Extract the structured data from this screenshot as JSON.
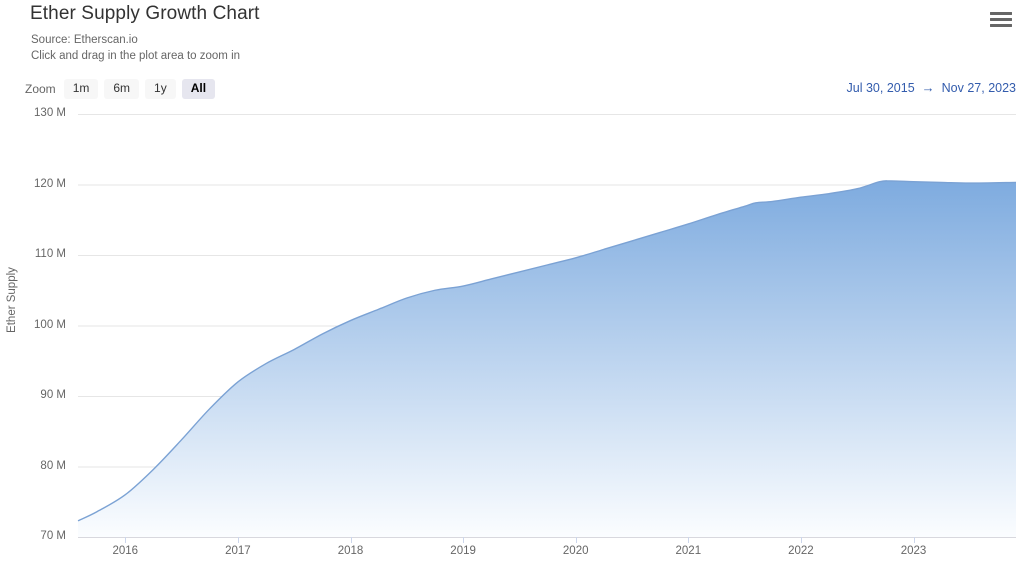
{
  "header": {
    "title": "Ether Supply Growth Chart",
    "source_line": "Source: Etherscan.io",
    "hint_line": "Click and drag in the plot area to zoom in",
    "menu_icon": "hamburger-menu-icon"
  },
  "range_selector": {
    "zoom_label": "Zoom",
    "buttons": [
      {
        "label": "1m",
        "active": false
      },
      {
        "label": "6m",
        "active": false
      },
      {
        "label": "1y",
        "active": false
      },
      {
        "label": "All",
        "active": true
      }
    ],
    "from_date": "Jul 30, 2015",
    "arrow": "→",
    "to_date": "Nov 27, 2023"
  },
  "colors": {
    "line": "#7ba2d4",
    "fill_top": "#7eabdf",
    "fill_bottom": "#fbfdff",
    "gridline": "#e6e6e6",
    "axis_text": "#666666",
    "link": "#335cad",
    "active_button_bg": "#e6e6ef"
  },
  "chart_data": {
    "type": "area",
    "title": "Ether Supply Growth Chart",
    "subtitle": "Source: Etherscan.io",
    "xlabel": "",
    "ylabel": "Ether Supply",
    "xlim": [
      2015.58,
      2023.91
    ],
    "ylim": [
      70,
      130
    ],
    "x_ticks": [
      "2016",
      "2017",
      "2018",
      "2019",
      "2020",
      "2021",
      "2022",
      "2023"
    ],
    "x_tick_values": [
      2016,
      2017,
      2018,
      2019,
      2020,
      2021,
      2022,
      2023
    ],
    "y_ticks": [
      "70 M",
      "80 M",
      "90 M",
      "100 M",
      "110 M",
      "120 M",
      "130 M"
    ],
    "y_tick_values": [
      70,
      80,
      90,
      100,
      110,
      120,
      130
    ],
    "grid": true,
    "legend": "none",
    "units": "millions of ETH",
    "series": [
      {
        "name": "Ether Supply",
        "x": [
          2015.58,
          2015.75,
          2016.0,
          2016.25,
          2016.5,
          2016.75,
          2017.0,
          2017.25,
          2017.5,
          2017.75,
          2018.0,
          2018.25,
          2018.5,
          2018.75,
          2019.0,
          2019.25,
          2019.5,
          2019.75,
          2020.0,
          2020.25,
          2020.5,
          2020.75,
          2021.0,
          2021.25,
          2021.5,
          2021.6,
          2021.75,
          2022.0,
          2022.25,
          2022.5,
          2022.7,
          2022.8,
          2023.0,
          2023.25,
          2023.5,
          2023.91
        ],
        "y": [
          72.3,
          73.6,
          76.0,
          79.6,
          83.8,
          88.2,
          92.0,
          94.6,
          96.6,
          98.8,
          100.7,
          102.3,
          103.9,
          105.0,
          105.6,
          106.6,
          107.6,
          108.6,
          109.6,
          110.8,
          112.0,
          113.2,
          114.4,
          115.7,
          116.9,
          117.4,
          117.6,
          118.2,
          118.7,
          119.4,
          120.4,
          120.5,
          120.4,
          120.3,
          120.2,
          120.3
        ]
      }
    ]
  }
}
